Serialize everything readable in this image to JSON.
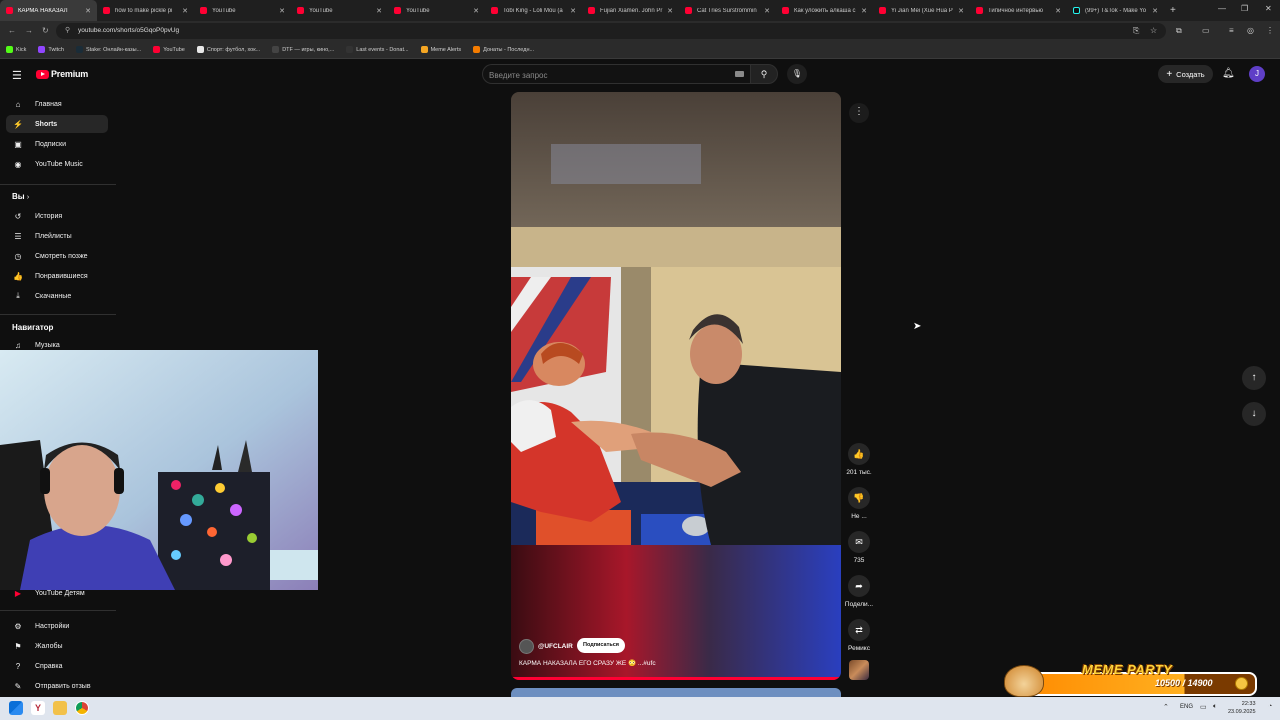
{
  "browser": {
    "tabs": [
      {
        "title": "КАРМА НАКАЗАЛ",
        "icon": "youtube-icon",
        "active": true
      },
      {
        "title": "how to make pickle pi",
        "icon": "youtube-icon"
      },
      {
        "title": "YouTube",
        "icon": "youtube-icon"
      },
      {
        "title": "YouTube",
        "icon": "youtube-icon"
      },
      {
        "title": "YouTube",
        "icon": "youtube-icon"
      },
      {
        "title": "Tobi King - Loli Mou (a",
        "icon": "youtube-icon"
      },
      {
        "title": "Fujian Xiamen. John Pr",
        "icon": "youtube-icon"
      },
      {
        "title": "Cat Tries Surströmmin",
        "icon": "youtube-icon"
      },
      {
        "title": "Как уложить алкаша c",
        "icon": "youtube-icon"
      },
      {
        "title": "Yi Jian Mei (Xue Hua P",
        "icon": "youtube-icon"
      },
      {
        "title": "Типичное интервью",
        "icon": "youtube-icon"
      },
      {
        "title": "(99+) T&Tok - Make Yo",
        "icon": "tiktok-icon"
      }
    ],
    "url": "youtube.com/shorts/o5GqoP0pvUg",
    "bookmarks": [
      {
        "label": "Kick",
        "color": "#53fc18"
      },
      {
        "label": "Twitch",
        "color": "#9146ff"
      },
      {
        "label": "Stake: Онлайн-казы...",
        "color": "#1a2c38"
      },
      {
        "label": "YouTube",
        "color": "#ff0033"
      },
      {
        "label": "Спорт: футбол, хок...",
        "color": "#e8e8e8"
      },
      {
        "label": "DTF — игры, кино,...",
        "color": "#444"
      },
      {
        "label": "Last events - Donat...",
        "color": "#333"
      },
      {
        "label": "Meme Alerts",
        "color": "#f5a623"
      },
      {
        "label": "Донаты - Последн...",
        "color": "#f57c00"
      }
    ]
  },
  "header": {
    "logo_text": "Premium",
    "search_placeholder": "Введите запрос",
    "create_label": "Создать",
    "avatar_letter": "J"
  },
  "sidebar": {
    "main": [
      {
        "label": "Главная",
        "icon": "home-icon",
        "glyph": "⌂"
      },
      {
        "label": "Shorts",
        "icon": "shorts-icon",
        "glyph": "⚡",
        "active": true
      },
      {
        "label": "Подписки",
        "icon": "subscriptions-icon",
        "glyph": "▣"
      },
      {
        "label": "YouTube Music",
        "icon": "music-icon",
        "glyph": "◉"
      }
    ],
    "you_heading": "Вы",
    "you_items": [
      {
        "label": "История",
        "icon": "history-icon",
        "glyph": "↺"
      },
      {
        "label": "Плейлисты",
        "icon": "playlists-icon",
        "glyph": "☰"
      },
      {
        "label": "Смотреть позже",
        "icon": "watch-later-icon",
        "glyph": "◷"
      },
      {
        "label": "Понравившиеся",
        "icon": "liked-icon",
        "glyph": "👍"
      },
      {
        "label": "Скачанные",
        "icon": "downloads-icon",
        "glyph": "⤓"
      }
    ],
    "nav_heading": "Навигатор",
    "nav_items": [
      {
        "label": "Музыка",
        "icon": "music-note-icon",
        "glyph": "♫"
      }
    ],
    "kids_item": {
      "label": "YouTube Детям",
      "icon": "youtube-kids-icon"
    },
    "bottom_items": [
      {
        "label": "Настройки",
        "icon": "settings-icon",
        "glyph": "⚙"
      },
      {
        "label": "Жалобы",
        "icon": "flag-icon",
        "glyph": "⚑"
      },
      {
        "label": "Справка",
        "icon": "help-icon",
        "glyph": "?"
      },
      {
        "label": "Отправить отзыв",
        "icon": "feedback-icon",
        "glyph": "✎"
      }
    ]
  },
  "short": {
    "channel": "@UFCLAIR",
    "subscribe_label": "Подписаться",
    "caption": "КАРМА НАКАЗАЛА ЕГО СРАЗУ ЖЕ 😳 ...#ufc",
    "actions": [
      {
        "name": "like",
        "icon": "thumbs-up-icon",
        "glyph": "👍",
        "label": "201 тыс."
      },
      {
        "name": "dislike",
        "icon": "thumbs-down-icon",
        "glyph": "👎",
        "label": "Не ..."
      },
      {
        "name": "comments",
        "icon": "comment-icon",
        "glyph": "✉",
        "label": "735"
      },
      {
        "name": "share",
        "icon": "share-icon",
        "glyph": "➦",
        "label": "Подели..."
      },
      {
        "name": "remix",
        "icon": "remix-icon",
        "glyph": "⇄",
        "label": "Ремикс"
      }
    ]
  },
  "overlay": {
    "meme_title": "MEME PARTY",
    "meme_count": "10500 / 14900",
    "meme_progress": 0.705
  },
  "taskbar": {
    "lang": "ENG",
    "time": "22:33",
    "date": "23.09.2025"
  }
}
